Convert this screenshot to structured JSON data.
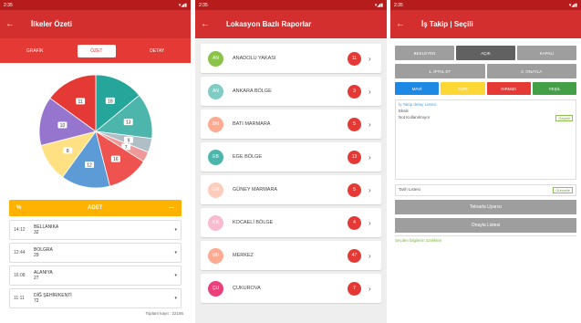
{
  "panel1": {
    "status": {
      "time": "2:35",
      "icons": "▾◢▮"
    },
    "title": "İlkeler Özeti",
    "tabs": [
      "GRAFİK",
      "ÖZET",
      "DETAY"
    ],
    "active_tab": 1,
    "yellow_bar": {
      "left": "%",
      "center": "ADET",
      "right": "—"
    },
    "rows": [
      {
        "time": "14:12",
        "name": "BELLANIKA",
        "sub": "32"
      },
      {
        "time": "12:44",
        "name": "BOLGRA",
        "sub": "29"
      },
      {
        "time": "16:08",
        "name": "ALANIYA",
        "sub": "27"
      },
      {
        "time": "11:11",
        "name": "DİĞ ŞEHİR/KENTİ",
        "sub": "72"
      }
    ],
    "footer": "Toplam kayıt : 22186",
    "chart_data": {
      "type": "pie",
      "slices": [
        {
          "label": "18",
          "value": 14,
          "color": "#26a69a"
        },
        {
          "label": "13",
          "value": 13,
          "color": "#4db6ac"
        },
        {
          "label": "9",
          "value": 4,
          "color": "#b0bec5"
        },
        {
          "label": "7",
          "value": 3,
          "color": "#ef9a9a"
        },
        {
          "label": "16",
          "value": 12,
          "color": "#ef5350"
        },
        {
          "label": "12",
          "value": 14,
          "color": "#5c9bd5"
        },
        {
          "label": "8",
          "value": 11,
          "color": "#ffe082"
        },
        {
          "label": "10",
          "value": 14,
          "color": "#9575cd"
        },
        {
          "label": "11",
          "value": 15,
          "color": "#e53935"
        }
      ]
    }
  },
  "panel2": {
    "status": {
      "time": "2:35",
      "icons": "▾◢▮"
    },
    "title": "Lokasyon Bazlı Raporlar",
    "items": [
      {
        "initials": "AN",
        "name": "ANADOLU YAKASI",
        "count": "11",
        "color": "#8bc34a"
      },
      {
        "initials": "AN",
        "name": "ANKARA BÖLGE",
        "count": "3",
        "color": "#80cbc4"
      },
      {
        "initials": "BM",
        "name": "BATI MARMARA",
        "count": "5",
        "color": "#ffab91"
      },
      {
        "initials": "EB",
        "name": "EGE BÖLGE",
        "count": "13",
        "color": "#4db6ac"
      },
      {
        "initials": "GM",
        "name": "GÜNEY MARMARA",
        "count": "5",
        "color": "#ffccbc"
      },
      {
        "initials": "KB",
        "name": "KOCAELİ BÖLGE",
        "count": "4",
        "color": "#f8bbd0"
      },
      {
        "initials": "MR",
        "name": "MERKEZ",
        "count": "47",
        "color": "#ffab91"
      },
      {
        "initials": "ÇU",
        "name": "ÇUKUROVA",
        "count": "7",
        "color": "#ec407a"
      }
    ]
  },
  "panel3": {
    "status": {
      "time": "2:35",
      "icons": "▾◢▮"
    },
    "title": "İş Takip | Seçili",
    "top_buttons": [
      "BEKLEYEN",
      "AÇIK",
      "KAPALI"
    ],
    "mid_buttons": [
      "1. İPTAL ET",
      "2. ONAYLA"
    ],
    "color_buttons": [
      {
        "label": "MAVİ",
        "color": "#1e88e5"
      },
      {
        "label": "SARI",
        "color": "#fdd835"
      },
      {
        "label": "KIRMIZI",
        "color": "#e53935"
      },
      {
        "label": "YEŞİL",
        "color": "#43a047"
      }
    ],
    "field": {
      "label": "İş Takip detay Listesi",
      "line1": "Eksik",
      "line2": "Not Kullanılmıyor",
      "tag": "Geçerli"
    },
    "field2": {
      "label": "Tarih Listesi",
      "tag": "Güncelle"
    },
    "button1": "Tekrarla Uyarısı",
    "button2": "Onayla Listesi",
    "note": "Seçilen bilgilerin özelikleri"
  }
}
